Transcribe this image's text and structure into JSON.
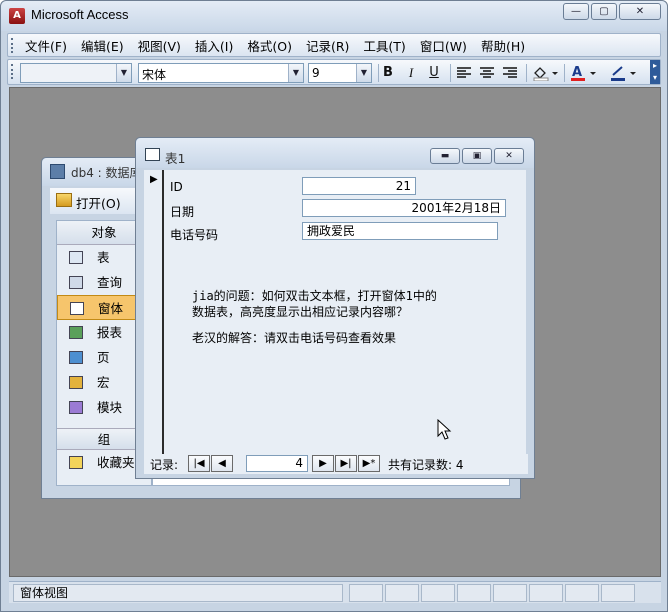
{
  "app": {
    "title": "Microsoft Access"
  },
  "menubar": {
    "items": [
      "文件(F)",
      "编辑(E)",
      "视图(V)",
      "插入(I)",
      "格式(O)",
      "记录(R)",
      "工具(T)",
      "窗口(W)",
      "帮助(H)"
    ]
  },
  "toolbar": {
    "object_combo": "",
    "font": "宋体",
    "size": "9",
    "bold": "B",
    "italic": "I",
    "underline": "U"
  },
  "database_window": {
    "title": "db4 : 数据库",
    "open_label": "打开(O)",
    "objects_header": "对象",
    "objects": [
      "表",
      "查询",
      "窗体",
      "报表",
      "页",
      "宏",
      "模块"
    ],
    "selected_object": "窗体",
    "groups_header": "组",
    "favorites": "收藏夹"
  },
  "form_window": {
    "title": "表1",
    "fields": {
      "id_label": "ID",
      "id_value": "21",
      "date_label": "日期",
      "date_value": "2001年2月18日",
      "phone_label": "电话号码",
      "phone_value": "拥政爱民"
    },
    "note_question": "jia的问题：如何双击文本框，打开窗体1中的\n数据表，高亮度显示出相应记录内容哪？",
    "note_answer": "老汉的解答：请双击电话号码查看效果",
    "nav": {
      "label": "记录:",
      "current": "4",
      "count_text": "共有记录数: 4"
    }
  },
  "statusbar": {
    "text": "窗体视图"
  }
}
